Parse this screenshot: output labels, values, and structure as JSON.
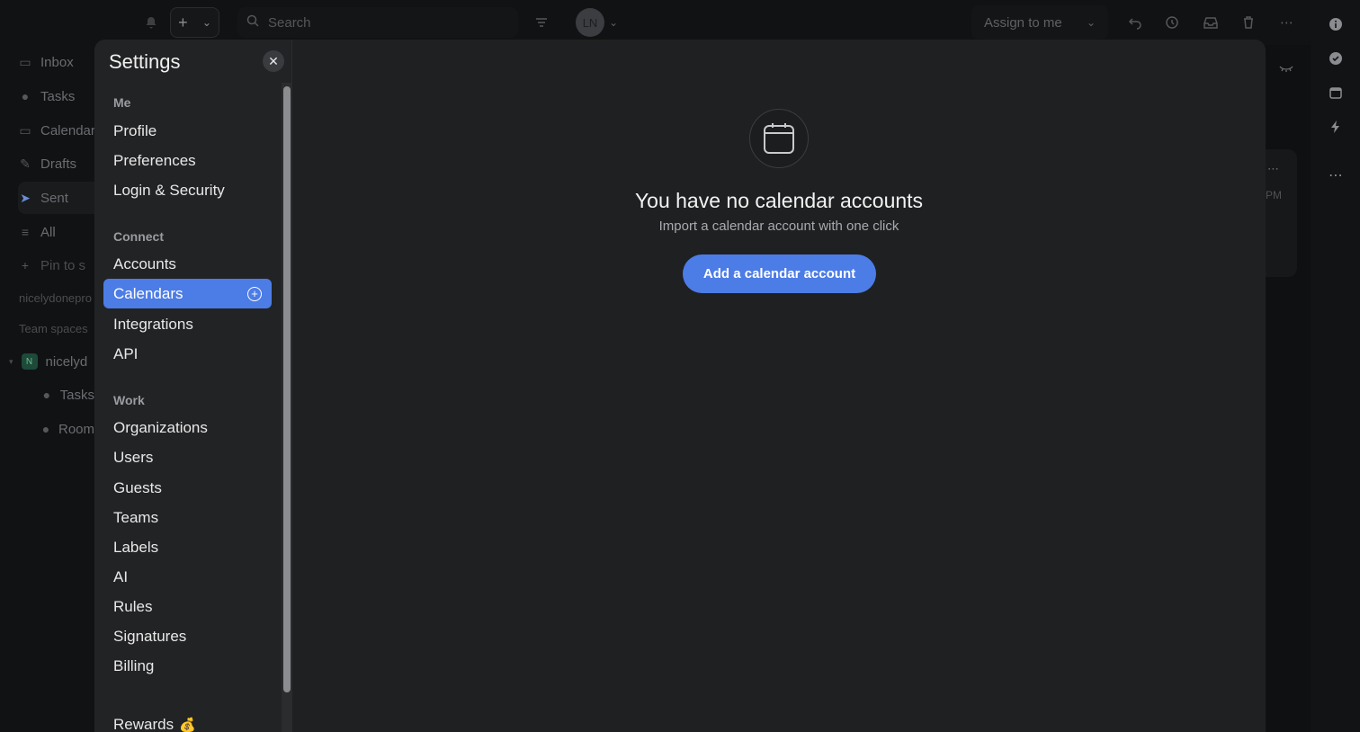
{
  "topbar": {
    "search_placeholder": "Search",
    "avatar_initials": "LN",
    "assign_label": "Assign to me"
  },
  "sidebar": {
    "items": [
      {
        "label": "Inbox",
        "icon": "inbox-icon"
      },
      {
        "label": "Tasks",
        "icon": "check-circle-icon"
      },
      {
        "label": "Calendar",
        "icon": "calendar-icon"
      },
      {
        "label": "Drafts",
        "icon": "pencil-icon"
      },
      {
        "label": "Sent",
        "icon": "send-icon"
      },
      {
        "label": "All",
        "icon": "stack-icon"
      },
      {
        "label": "Pin to s",
        "icon": "plus-icon"
      }
    ],
    "workspace_email": "nicelydonepro",
    "team_spaces_label": "Team spaces",
    "team": {
      "badge": "N",
      "name": "nicelyd"
    },
    "team_items": [
      {
        "label": "Tasks",
        "icon": "check-circle-icon"
      },
      {
        "label": "Room",
        "icon": "chat-bubble-icon"
      }
    ]
  },
  "settings": {
    "title": "Settings",
    "close_icon": "close-icon",
    "sections": [
      {
        "label": "Me",
        "items": [
          "Profile",
          "Preferences",
          "Login & Security"
        ]
      },
      {
        "label": "Connect",
        "items": [
          "Accounts",
          "Calendars",
          "Integrations",
          "API"
        ]
      },
      {
        "label": "Work",
        "items": [
          "Organizations",
          "Users",
          "Guests",
          "Teams",
          "Labels",
          "AI",
          "Rules",
          "Signatures",
          "Billing"
        ]
      }
    ],
    "selected": "Calendars",
    "rewards_label": "Rewards",
    "rewards_emoji": "💰"
  },
  "empty_state": {
    "icon": "calendar-icon",
    "title": "You have no calendar accounts",
    "subtitle": "Import a calendar account with one click",
    "button_label": "Add a calendar account"
  },
  "bg_card": {
    "time_fragment": "PM"
  },
  "colors": {
    "accent": "#4c7ce6",
    "modal_bg": "#1f2022",
    "sidebar_bg": "#222325"
  }
}
